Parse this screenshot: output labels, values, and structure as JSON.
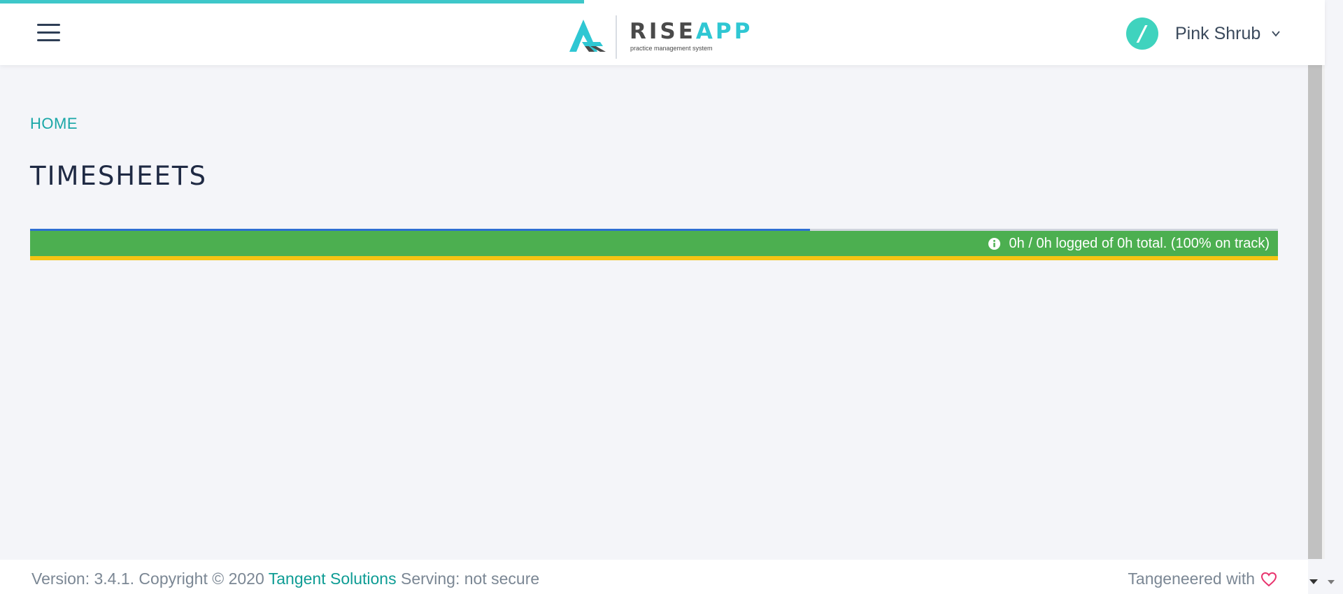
{
  "header": {
    "logo": {
      "brand_part1": "RISE",
      "brand_part2": "APP",
      "tagline": "practice management system"
    },
    "user": {
      "avatar_glyph": "/",
      "name": "Pink Shrub"
    }
  },
  "breadcrumb": {
    "home": "HOME"
  },
  "page": {
    "title": "TIMESHEETS"
  },
  "progress": {
    "summary": "0h / 0h logged of 0h total. (100% on track)",
    "top_bar_fraction": 0.625,
    "colors": {
      "main": "#4caf50",
      "top_fill": "#2e6fd1",
      "bottom": "#f5c414"
    }
  },
  "footer": {
    "version_text": "Version: 3.4.1. Copyright © 2020 ",
    "company_link": "Tangent Solutions",
    "serving_text": " Serving: not secure",
    "credit_text": "Tangeneered with"
  },
  "colors": {
    "accent": "#3ec7c9",
    "brand_app": "#2fc7d3",
    "avatar": "#3fd3be",
    "link": "#0e9c94",
    "heart": "#e8336d"
  },
  "icons": {
    "menu": "hamburger-icon",
    "dropdown": "chevron-down-icon",
    "info": "info-icon",
    "heart": "heart-icon"
  }
}
